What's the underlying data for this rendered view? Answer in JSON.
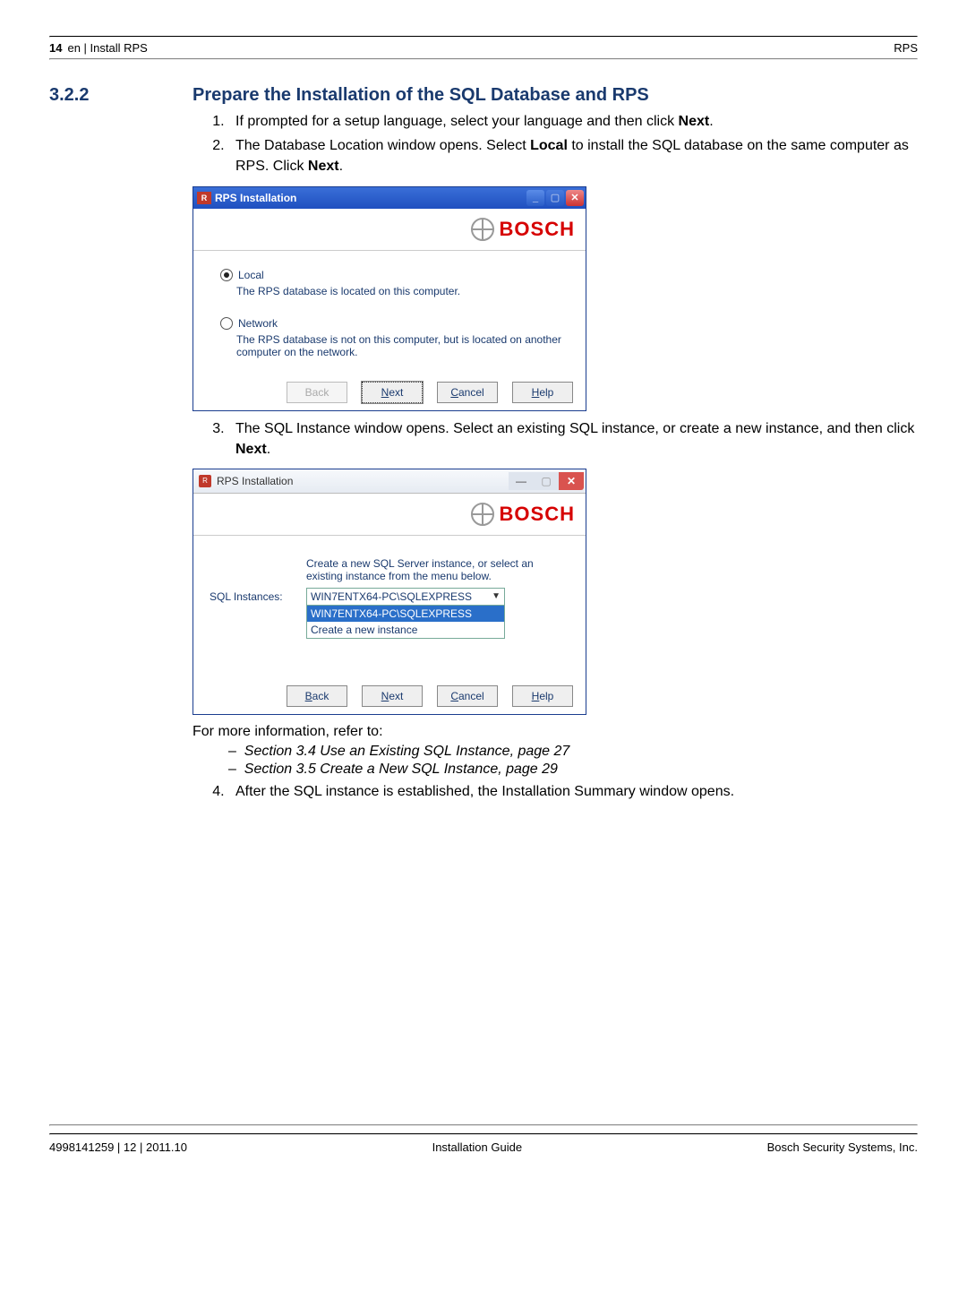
{
  "header": {
    "page_num": "14",
    "breadcrumb": "en | Install RPS",
    "right": "RPS"
  },
  "section": {
    "num": "3.2.2",
    "title": "Prepare the Installation of the SQL Database and RPS",
    "step1": "If prompted for a setup language, select your language and then click ",
    "step1_b": "Next",
    "step1_end": ".",
    "step2a": "The Database Location window opens. Select ",
    "step2_b1": "Local",
    "step2b": " to install the SQL database on the same computer as RPS. Click ",
    "step2_b2": "Next",
    "step2_end": ".",
    "step3": "The SQL Instance window opens. Select an existing SQL instance, or create a new instance, and then click ",
    "step3_b": "Next",
    "step3_end": ".",
    "more_info": "For more information, refer to:",
    "ref1": "Section 3.4 Use an Existing SQL Instance, page 27",
    "ref2": "Section 3.5 Create a New SQL Instance, page 29",
    "step4": "After the SQL instance is established, the Installation Summary window opens."
  },
  "dialog1": {
    "title": "RPS Installation",
    "brand": "BOSCH",
    "local_label": "Local",
    "local_desc": "The RPS  database is located on this computer.",
    "net_label": "Network",
    "net_desc": "The RPS database is not on this computer, but is located on another computer on the network.",
    "back": "Back",
    "next_u": "N",
    "next_rest": "ext",
    "cancel_u": "C",
    "cancel_rest": "ancel",
    "help_u": "H",
    "help_rest": "elp"
  },
  "dialog2": {
    "title": "RPS Installation",
    "brand": "BOSCH",
    "prompt": "Create a new SQL Server instance, or select an existing instance from the menu below.",
    "label": "SQL Instances:",
    "selected": "WIN7ENTX64-PC\\SQLEXPRESS",
    "opt1": "WIN7ENTX64-PC\\SQLEXPRESS",
    "opt2": "Create a new instance",
    "back_u": "B",
    "back_rest": "ack",
    "next_u": "N",
    "next_rest": "ext",
    "cancel_u": "C",
    "cancel_rest": "ancel",
    "help_u": "H",
    "help_rest": "elp"
  },
  "footer": {
    "left": "4998141259 | 12 | 2011.10",
    "center": "Installation Guide",
    "right": "Bosch Security Systems, Inc."
  }
}
